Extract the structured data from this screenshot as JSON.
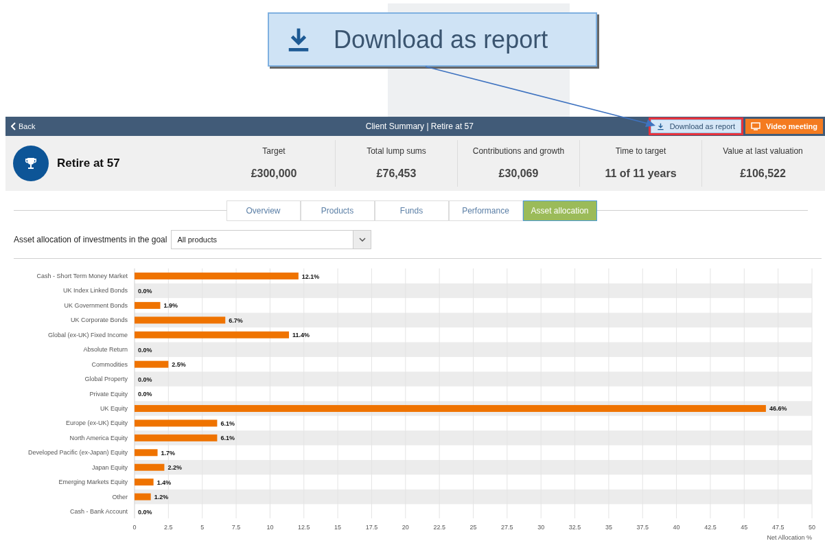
{
  "callout": {
    "label": "Download as report"
  },
  "header": {
    "back": "Back",
    "title": "Client Summary | Retire at 57",
    "actions": [
      {
        "kind": "download",
        "label": "Download as report",
        "highlighted": true
      },
      {
        "kind": "video",
        "label": "Video meeting",
        "highlighted": false
      }
    ]
  },
  "summary": {
    "goal": "Retire at 57",
    "stats": [
      {
        "label": "Target",
        "value": "£300,000"
      },
      {
        "label": "Total lump sums",
        "value": "£76,453"
      },
      {
        "label": "Contributions and growth",
        "value": "£30,069"
      },
      {
        "label": "Time to target",
        "value": "11 of 11 years"
      },
      {
        "label": "Value at last valuation",
        "value": "£106,522"
      }
    ]
  },
  "tabs": [
    {
      "label": "Overview",
      "selected": false
    },
    {
      "label": "Products",
      "selected": false
    },
    {
      "label": "Funds",
      "selected": false
    },
    {
      "label": "Performance",
      "selected": false
    },
    {
      "label": "Asset allocation",
      "selected": true
    }
  ],
  "filter": {
    "label": "Asset allocation of investments in the goal",
    "value": "All products"
  },
  "chart_data": {
    "type": "bar",
    "orientation": "horizontal",
    "xlabel": "Net Allocation %",
    "categories": [
      "Cash - Short Term Money Market",
      "UK Index Linked Bonds",
      "UK Government Bonds",
      "UK Corporate Bonds",
      "Global (ex-UK) Fixed Income",
      "Absolute Return",
      "Commodities",
      "Global Property",
      "Private Equity",
      "UK Equity",
      "Europe (ex-UK) Equity",
      "North America Equity",
      "Developed Pacific (ex-Japan) Equity",
      "Japan Equity",
      "Emerging Markets Equity",
      "Other",
      "Cash - Bank Account"
    ],
    "grid": true,
    "series": [
      {
        "color": "#ef7300",
        "values": [
          12.1,
          0,
          1.9,
          6.7,
          11.4,
          0,
          2.5,
          0,
          0,
          46.6,
          6.1,
          6.1,
          1.7,
          2.2,
          1.4,
          1.2,
          0
        ]
      }
    ],
    "value_labels": [
      "12.1%",
      "0.0%",
      "1.9%",
      "6.7%",
      "11.4%",
      "0.0%",
      "2.5%",
      "0.0%",
      "0.0%",
      "46.6%",
      "6.1%",
      "6.1%",
      "1.7%",
      "2.2%",
      "1.4%",
      "1.2%",
      "0.0%"
    ],
    "xlim": [
      0,
      50
    ],
    "xticks": [
      0,
      2.5,
      5,
      7.5,
      10,
      12.5,
      15,
      17.5,
      20,
      22.5,
      25,
      27.5,
      30,
      32.5,
      35,
      37.5,
      40,
      42.5,
      45,
      47.5,
      50
    ]
  }
}
